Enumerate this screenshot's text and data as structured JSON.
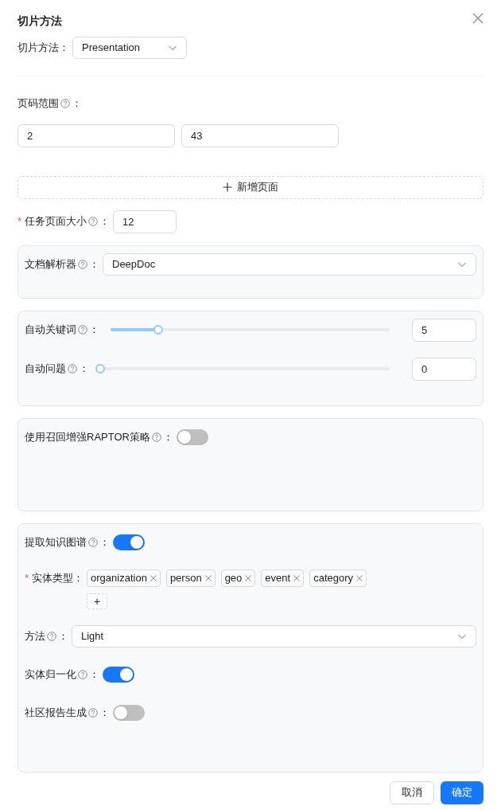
{
  "dialog": {
    "title": "切片方法"
  },
  "chunk_method": {
    "label": "切片方法",
    "colon": "：",
    "value": "Presentation"
  },
  "page_ranges": {
    "label": "页码范围",
    "colon": "：",
    "help": true,
    "from": "2",
    "to": "43",
    "add_label": "新增页面"
  },
  "task_page_size": {
    "label": "任务页面大小",
    "colon": "：",
    "help": true,
    "required_mark": "*",
    "value": "12"
  },
  "sections": [
    {
      "fields": [
        {
          "kind": "select",
          "label": "文档解析器",
          "help": true,
          "colon": "：",
          "value": "DeepDoc"
        }
      ]
    },
    {
      "fields": [
        {
          "kind": "slider",
          "label": "自动关键词",
          "help": true,
          "colon": "：",
          "level": 0.17,
          "value": "5"
        },
        {
          "kind": "slider",
          "label": "自动问题",
          "help": true,
          "colon": "：",
          "level": 0,
          "value": "0"
        }
      ]
    },
    {
      "fields": [
        {
          "kind": "switch",
          "label": "使用召回增强RAPTOR策略",
          "help": true,
          "colon": "：",
          "on": false
        }
      ]
    },
    {
      "fields": [
        {
          "kind": "switch",
          "label": "提取知识图谱",
          "help": true,
          "colon": "：",
          "on": true
        },
        {
          "kind": "tags",
          "label": "实体类型",
          "help": false,
          "required_mark": "*",
          "colon": "：",
          "tags": [
            "organization",
            "person",
            "geo",
            "event",
            "category"
          ],
          "add": "+"
        },
        {
          "kind": "select",
          "label": "方法",
          "help": true,
          "colon": "：",
          "value": "Light"
        },
        {
          "kind": "switch",
          "label": "实体归一化",
          "help": true,
          "colon": "：",
          "on": true
        },
        {
          "kind": "switch",
          "label": "社区报告生成",
          "help": true,
          "colon": "：",
          "on": false
        }
      ]
    }
  ],
  "footer": {
    "cancel": "取消",
    "ok": "确定"
  }
}
